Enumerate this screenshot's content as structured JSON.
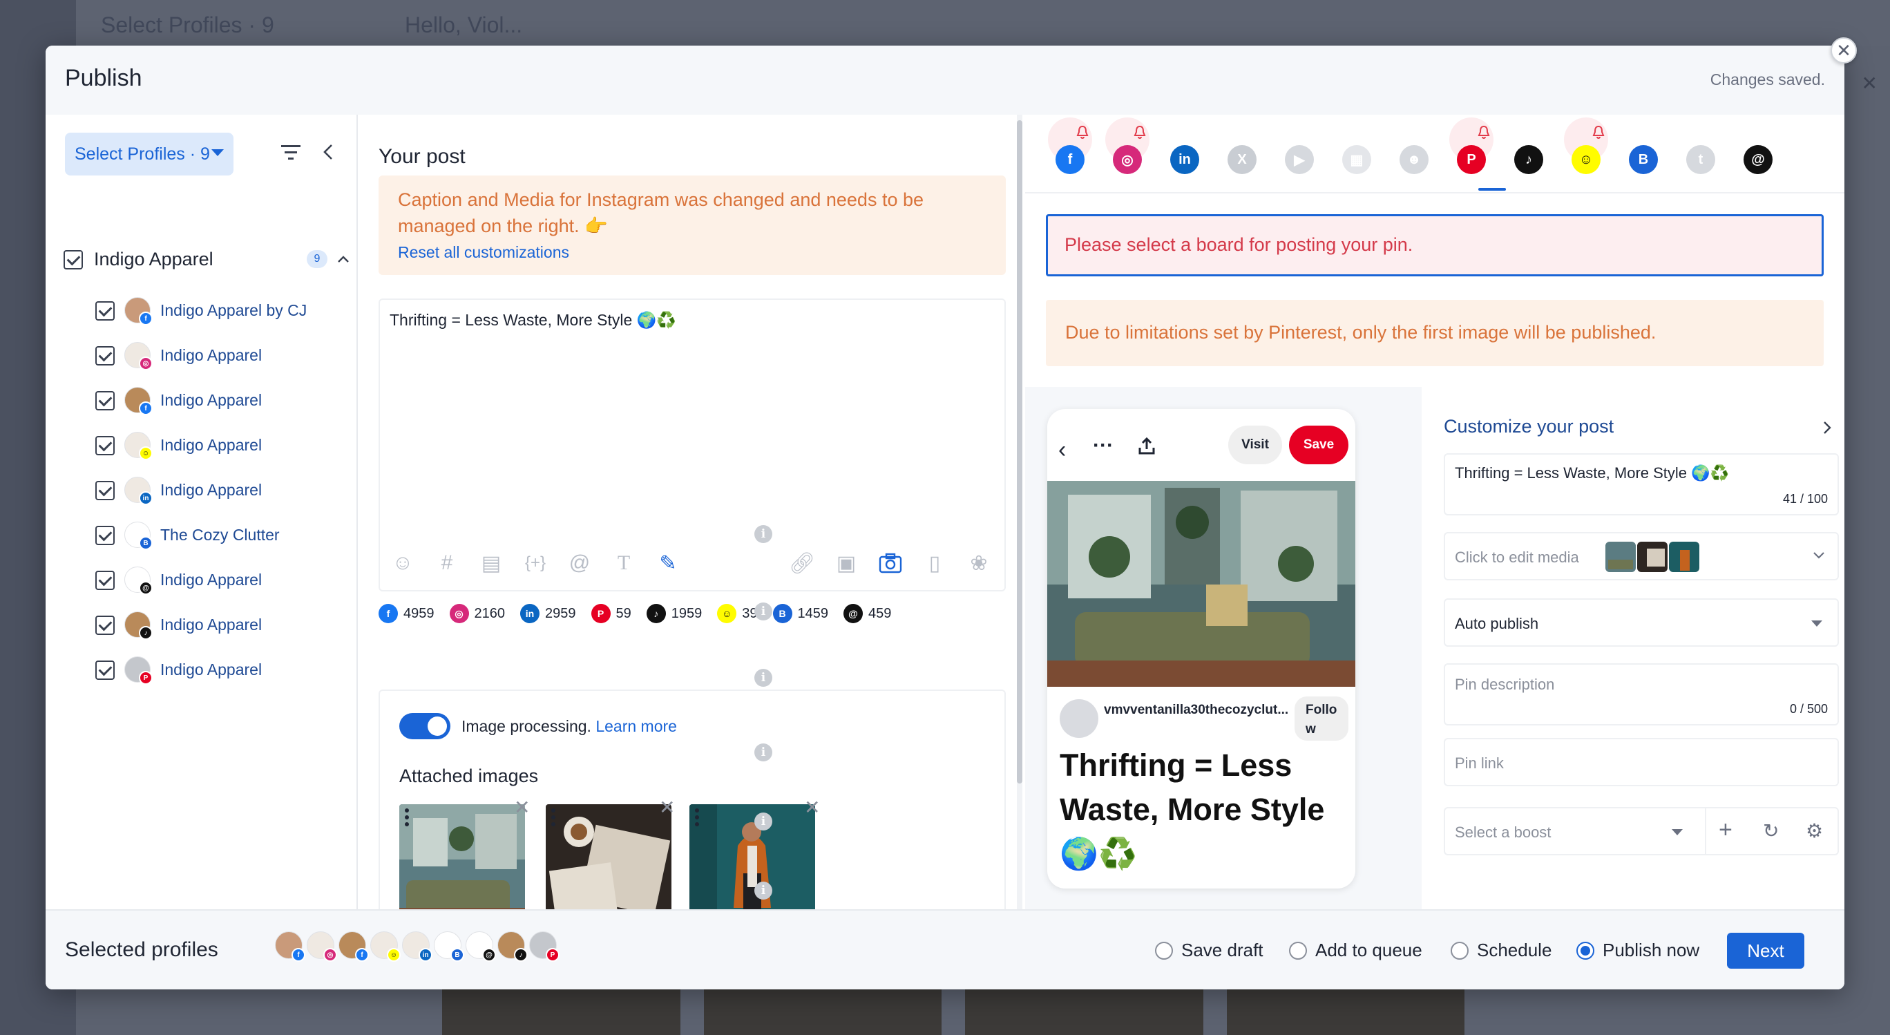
{
  "background": {
    "top_ghost_left": "Select Profiles · 9",
    "top_ghost_right": "Hello, Viol..."
  },
  "modal": {
    "title": "Publish",
    "status": "Changes saved."
  },
  "left": {
    "select_profiles_label": "Select Profiles · 9",
    "group": {
      "name": "Indigo Apparel",
      "count": "9"
    },
    "profiles": [
      {
        "name": "Indigo Apparel by CJ",
        "network": "facebook",
        "net_color": "#1877f2",
        "net_glyph": "f",
        "avatar": "#c99a7a"
      },
      {
        "name": "Indigo Apparel",
        "network": "instagram",
        "net_color": "#d6297a",
        "net_glyph": "◎",
        "avatar": "#efe9e2"
      },
      {
        "name": "Indigo Apparel",
        "network": "facebook",
        "net_color": "#1877f2",
        "net_glyph": "f",
        "avatar": "#b98a5a"
      },
      {
        "name": "Indigo Apparel",
        "network": "snapchat",
        "net_color": "#fffc00",
        "net_glyph": "☺",
        "avatar": "#efe9e2"
      },
      {
        "name": "Indigo Apparel",
        "network": "linkedin",
        "net_color": "#0a66c2",
        "net_glyph": "in",
        "avatar": "#efe9e2"
      },
      {
        "name": "The Cozy Clutter",
        "network": "google-business",
        "net_color": "#1a64d6",
        "net_glyph": "B",
        "avatar": "#ffffff"
      },
      {
        "name": "Indigo Apparel",
        "network": "threads",
        "net_color": "#111111",
        "net_glyph": "@",
        "avatar": "#ffffff"
      },
      {
        "name": "Indigo Apparel",
        "network": "tiktok",
        "net_color": "#111111",
        "net_glyph": "♪",
        "avatar": "#b98a5a"
      },
      {
        "name": "Indigo Apparel",
        "network": "pinterest",
        "net_color": "#e60023",
        "net_glyph": "P",
        "avatar": "#c4c7cc"
      }
    ]
  },
  "middle": {
    "heading": "Your post",
    "warning": "Caption and Media for Instagram was changed and needs to be managed on the right. 👉",
    "reset_link": "Reset all customizations",
    "post_text": "Thrifting = Less Waste, More Style 🌍♻️",
    "counts": [
      {
        "network": "facebook",
        "color": "#1877f2",
        "glyph": "f",
        "value": "4959"
      },
      {
        "network": "instagram",
        "color": "#d6297a",
        "glyph": "◎",
        "value": "2160"
      },
      {
        "network": "linkedin",
        "color": "#0a66c2",
        "glyph": "in",
        "value": "2959"
      },
      {
        "network": "pinterest",
        "color": "#e60023",
        "glyph": "P",
        "value": "59"
      },
      {
        "network": "tiktok",
        "color": "#111111",
        "glyph": "♪",
        "value": "1959"
      },
      {
        "network": "snapchat",
        "color": "#fffc00",
        "glyph": "☺",
        "value": "39"
      },
      {
        "network": "google-business",
        "color": "#1a64d6",
        "glyph": "B",
        "value": "1459"
      },
      {
        "network": "threads",
        "color": "#111111",
        "glyph": "@",
        "value": "459"
      }
    ],
    "image_processing": "Image processing.",
    "learn_more": "Learn more",
    "attached_title": "Attached images"
  },
  "right": {
    "networks": [
      {
        "name": "facebook",
        "color": "#1877f2",
        "glyph": "f",
        "bell": true,
        "active": false
      },
      {
        "name": "instagram",
        "color": "#d6297a",
        "glyph": "◎",
        "bell": true,
        "active": false
      },
      {
        "name": "linkedin",
        "color": "#0a66c2",
        "glyph": "in",
        "bell": false,
        "active": false
      },
      {
        "name": "x",
        "color": "#c9cdd3",
        "glyph": "X",
        "bell": false,
        "active": false
      },
      {
        "name": "youtube",
        "color": "#d6d9de",
        "glyph": "▶",
        "bell": false,
        "active": false
      },
      {
        "name": "google-ads",
        "color": "#e4e6ea",
        "glyph": "▦",
        "bell": false,
        "active": false
      },
      {
        "name": "reddit",
        "color": "#d6d9de",
        "glyph": "☻",
        "bell": false,
        "active": false
      },
      {
        "name": "pinterest",
        "color": "#e60023",
        "glyph": "P",
        "bell": true,
        "active": true
      },
      {
        "name": "tiktok",
        "color": "#111111",
        "glyph": "♪",
        "bell": false,
        "active": false
      },
      {
        "name": "snapchat",
        "color": "#fffc00",
        "glyph": "☺",
        "bell": true,
        "active": false
      },
      {
        "name": "google-business",
        "color": "#1a64d6",
        "glyph": "B",
        "bell": false,
        "active": false
      },
      {
        "name": "tumblr",
        "color": "#d6d9de",
        "glyph": "t",
        "bell": false,
        "active": false
      },
      {
        "name": "threads",
        "color": "#111111",
        "glyph": "@",
        "bell": false,
        "active": false
      }
    ],
    "error": "Please select a board for posting your pin.",
    "limitation": "Due to limitations set by Pinterest, only the first image will be published.",
    "preview": {
      "visit": "Visit",
      "save": "Save",
      "username": "vmvventanilla30thecozyclut...",
      "follow": "Follo w",
      "title": "Thrifting = Less Waste, More Style 🌍♻️"
    },
    "customize": {
      "title": "Customize your post",
      "caption": "Thrifting = Less Waste, More Style 🌍♻️",
      "caption_count": "41 / 100",
      "media_label": "Click to edit media",
      "publish_mode": "Auto publish",
      "pin_description_placeholder": "Pin description",
      "pin_description_count": "0 / 500",
      "pin_link_placeholder": "Pin link",
      "boost_placeholder": "Select a boost"
    }
  },
  "footer": {
    "selected_title": "Selected profiles",
    "options": [
      "Save draft",
      "Add to queue",
      "Schedule",
      "Publish now"
    ],
    "selected_option": "Publish now",
    "next": "Next"
  }
}
